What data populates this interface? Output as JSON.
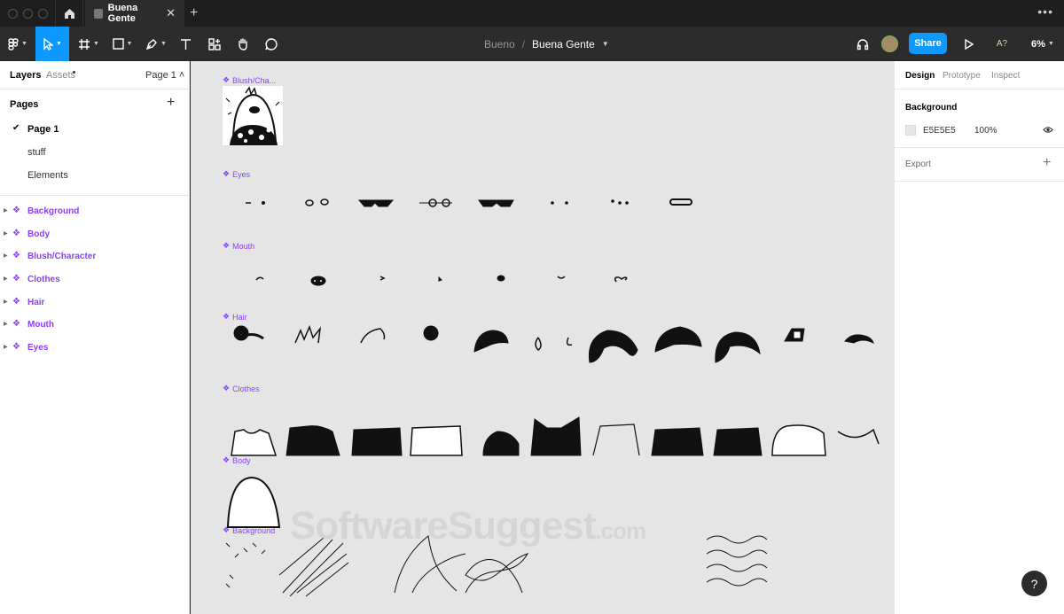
{
  "tabs": {
    "active_file": "Buena Gente",
    "close": "✕",
    "new_tab": "+",
    "more": "•••"
  },
  "toolbar": {
    "project": "Bueno",
    "separator": "/",
    "file_name": "Buena Gente",
    "share_label": "Share",
    "zoom": "6%",
    "ai_label": "A?"
  },
  "left_panel": {
    "tab_layers": "Layers",
    "tab_assets": "Assets",
    "page_selector": "Page 1 ˄",
    "pages_title": "Pages",
    "pages": [
      {
        "name": "Page 1",
        "selected": true
      },
      {
        "name": "stuff",
        "selected": false
      },
      {
        "name": "Elements",
        "selected": false
      }
    ],
    "layers": [
      "Background",
      "Body",
      "Blush/Character",
      "Clothes",
      "Hair",
      "Mouth",
      "Eyes"
    ]
  },
  "canvas": {
    "background": "#E5E5E5",
    "frames": [
      "Blush/Cha...",
      "Eyes",
      "Mouth",
      "Hair",
      "Clothes",
      "Body",
      "Background"
    ],
    "watermark": "SoftwareSuggest",
    "watermark_suffix": ".com"
  },
  "right_panel": {
    "tab_design": "Design",
    "tab_prototype": "Prototype",
    "tab_inspect": "Inspect",
    "background_title": "Background",
    "background_hex": "E5E5E5",
    "background_opacity": "100%",
    "export_title": "Export"
  },
  "help": "?"
}
